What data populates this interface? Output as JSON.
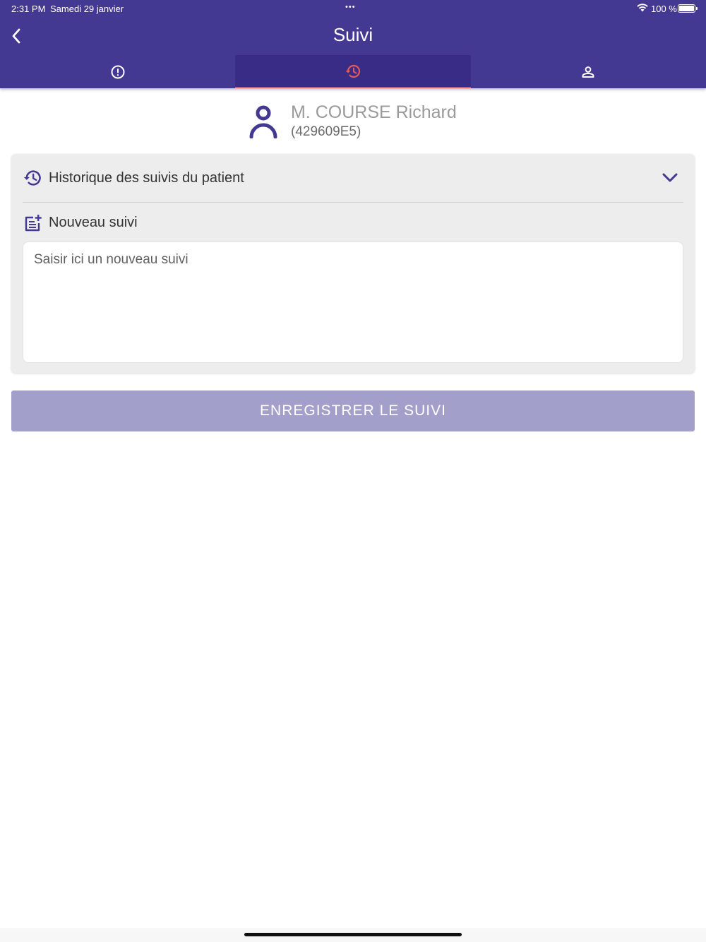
{
  "status_bar": {
    "time": "2:31 PM",
    "date": "Samedi 29 janvier",
    "dots": "•••",
    "battery": "100 %"
  },
  "header": {
    "title": "Suivi",
    "tabs": [
      {
        "icon": "alert-circle-icon",
        "active": false
      },
      {
        "icon": "history-icon",
        "active": true
      },
      {
        "icon": "person-icon",
        "active": false
      }
    ]
  },
  "patient": {
    "name": "M. COURSE Richard",
    "id": "(429609E5)"
  },
  "history": {
    "label": "Historique des suivis du patient"
  },
  "new_followup": {
    "label": "Nouveau suivi",
    "placeholder": "Saisir ici un nouveau suivi",
    "value": ""
  },
  "save_button": {
    "label": "ENREGISTRER LE SUIVI"
  },
  "colors": {
    "primary": "#433993",
    "active_tab": "#382c86",
    "active_indicator": "#e35a5a",
    "button_disabled": "#a39fcb"
  }
}
